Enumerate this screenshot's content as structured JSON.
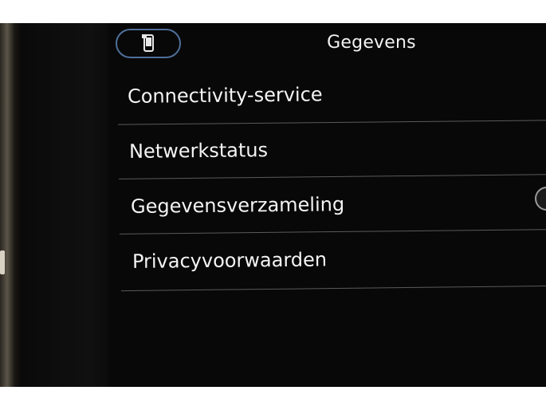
{
  "header": {
    "title": "Gegevens",
    "phone_icon": "phone-icon"
  },
  "menu": {
    "items": [
      {
        "label": "Connectivity-service"
      },
      {
        "label": "Netwerkstatus"
      },
      {
        "label": "Gegevensverzameling",
        "toggle": "toggle"
      },
      {
        "label": "Privacyvoorwaarden"
      }
    ]
  },
  "colors": {
    "accent": "#4f6f9a",
    "text": "#f4f4f4",
    "background": "#080808"
  }
}
